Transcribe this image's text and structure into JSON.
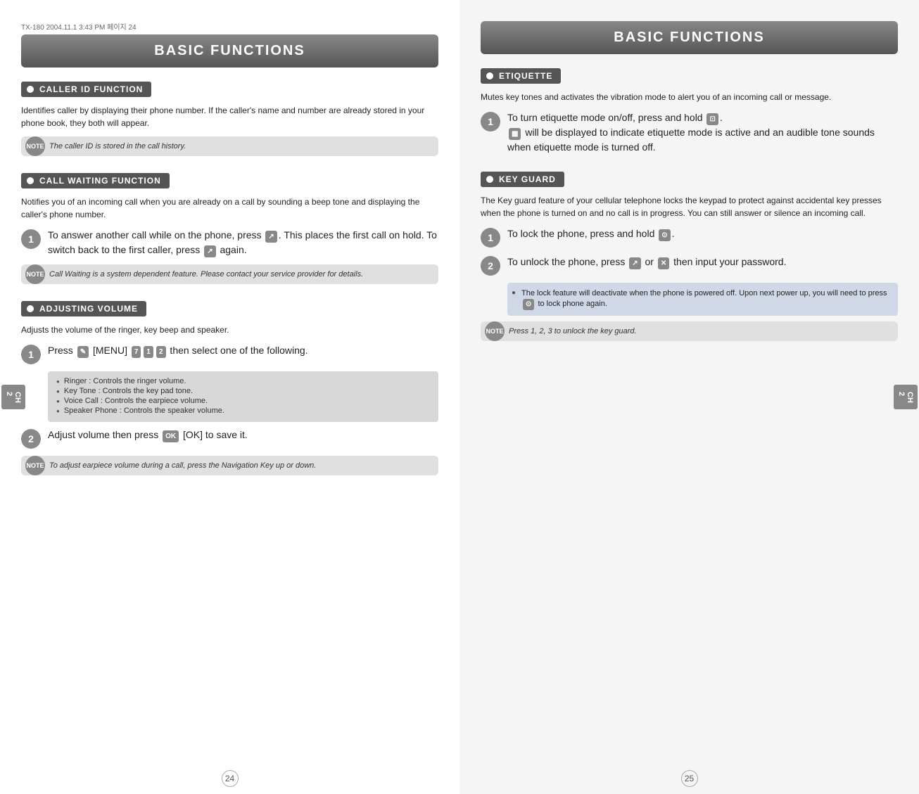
{
  "left": {
    "top_label": "TX-180  2004.11.1  3:43 PM  페이지 24",
    "header": "BASIC FUNCTIONS",
    "side_tab": "CH\n2",
    "sections": [
      {
        "id": "caller-id",
        "title": "CALLER ID FUNCTION",
        "body": "Identifies caller by displaying their phone number.  If the caller's name and number are already stored in your phone book, they both will appear.",
        "note": "The caller ID is stored in the call history."
      },
      {
        "id": "call-waiting",
        "title": "CALL WAITING FUNCTION",
        "body": "Notifies you of an incoming call when you are already on a call by sounding a beep tone and displaying the caller's phone number.",
        "step1": "To answer another call while on the phone, press      . This places the first call on hold. To switch back to the first caller, press      again.",
        "note": "Call Waiting is a system dependent feature. Please contact your service provider for details."
      },
      {
        "id": "adjusting-volume",
        "title": "ADJUSTING VOLUME",
        "body": "Adjusts the volume of the ringer, key beep and speaker.",
        "step1": "Press      [MENU]              then select one of the following.",
        "bullets": [
          "Ringer : Controls the ringer volume.",
          "Key Tone : Controls the key pad tone.",
          "Voice Call : Controls the earpiece volume.",
          "Speaker Phone : Controls the speaker volume."
        ],
        "step2": "Adjust volume then press      [OK] to save it.",
        "note": "To adjust earpiece volume during a call, press the Navigation Key up or down."
      }
    ],
    "page_number": "24"
  },
  "right": {
    "header": "BASIC FUNCTIONS",
    "side_tab": "CH\n2",
    "sections": [
      {
        "id": "etiquette",
        "title": "ETIQUETTE",
        "body": "Mutes key tones and activates the vibration mode to alert you of an incoming call or message.",
        "step1": "To turn etiquette mode on/off, press and hold      .      will be displayed to indicate etiquette mode is active and an audible tone sounds when etiquette mode is turned off."
      },
      {
        "id": "key-guard",
        "title": "KEY GUARD",
        "body": "The Key guard feature of your cellular telephone locks the keypad to protect against accidental key presses when the phone is turned on and no call is in progress. You can still answer or silence an incoming call.",
        "step1": "To lock the phone, press and hold      .",
        "step2": "To unlock the phone, press      or      then input your password.",
        "info": "The lock feature will deactivate when the phone is powered off. Upon next power up, you will need to press      to lock phone again.",
        "note": "Press 1, 2, 3 to unlock the key guard."
      }
    ],
    "page_number": "25"
  }
}
